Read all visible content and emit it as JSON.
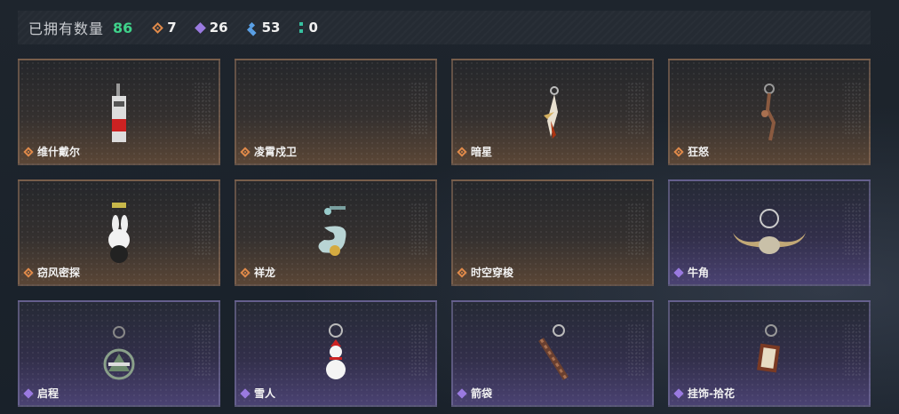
{
  "header": {
    "title": "已拥有数量",
    "total": "86",
    "stats": [
      {
        "icon": "orange-diamond-icon",
        "value": "7"
      },
      {
        "icon": "purple-diamond-icon",
        "value": "26"
      },
      {
        "icon": "blue-diamond-icon",
        "value": "53"
      },
      {
        "icon": "teal-bar-icon",
        "value": "0"
      }
    ]
  },
  "colors": {
    "accent_green": "#3fd28a",
    "rarity_orange": "#e08a4a",
    "rarity_purple": "#9a7ae0",
    "rarity_blue": "#5aa0e6"
  },
  "cards": [
    {
      "name": "维什戴尔",
      "rarity": "orange",
      "icon": "tag-charm-icon"
    },
    {
      "name": "凌霄戍卫",
      "rarity": "orange",
      "icon": ""
    },
    {
      "name": "暗星",
      "rarity": "orange",
      "icon": "feather-charm-icon"
    },
    {
      "name": "狂怒",
      "rarity": "orange",
      "icon": "chain-charm-icon"
    },
    {
      "name": "窃风密探",
      "rarity": "orange",
      "icon": "rabbit-charm-icon"
    },
    {
      "name": "祥龙",
      "rarity": "orange",
      "icon": "dragon-charm-icon"
    },
    {
      "name": "时空穿梭",
      "rarity": "orange",
      "icon": ""
    },
    {
      "name": "牛角",
      "rarity": "purple",
      "icon": "horns-charm-icon"
    },
    {
      "name": "启程",
      "rarity": "purple",
      "icon": "badge-charm-icon"
    },
    {
      "name": "雪人",
      "rarity": "purple",
      "icon": "snowman-charm-icon"
    },
    {
      "name": "箭袋",
      "rarity": "purple",
      "icon": "quiver-charm-icon"
    },
    {
      "name": "挂饰-拾花",
      "rarity": "purple",
      "icon": "frame-charm-icon"
    }
  ]
}
